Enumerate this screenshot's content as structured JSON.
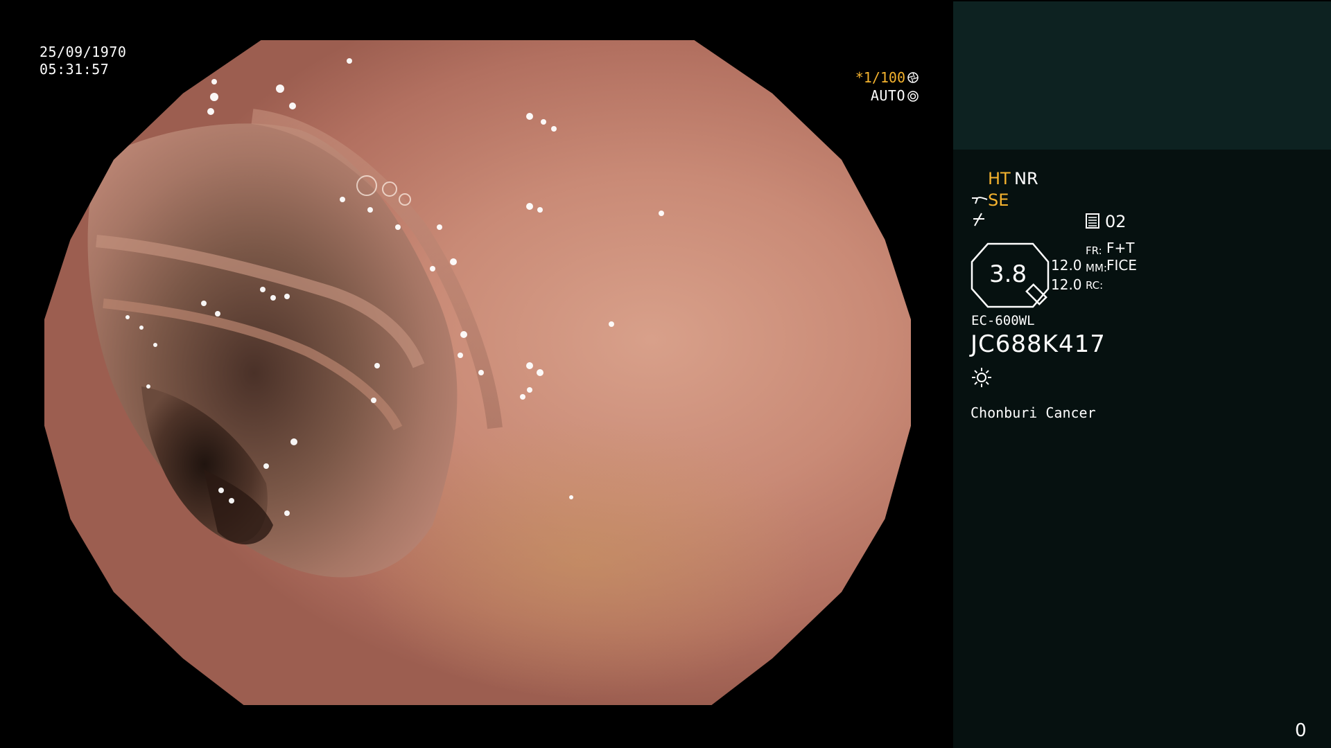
{
  "overlay": {
    "date": "25/09/1970",
    "time": "05:31:57",
    "shutter": "*1/100",
    "shutter_icon": "aperture-icon",
    "auto_label": "AUTO",
    "auto_icon": "iris-icon"
  },
  "panel": {
    "ht_label": "HT",
    "nr_label": "NR",
    "se_label": "SE",
    "memory_value": "02",
    "zoom_value": "3.8",
    "value_1": "12.0",
    "value_2": "12.0",
    "fr_label": "FR:",
    "fr_value": "F+T",
    "mm_label": "MM:",
    "mm_value": "FICE",
    "rc_label": "RC:",
    "rc_value": "",
    "scope_model": "EC-600WL",
    "scope_id": "JC688K417",
    "light_icon": "sun-icon",
    "hospital": "Chonburi Cancer",
    "counter": "0"
  },
  "colors": {
    "accent_yellow": "#f5b32e",
    "panel_top": "#0d2221",
    "panel_bottom": "#061110",
    "tissue": "#c98a76"
  }
}
